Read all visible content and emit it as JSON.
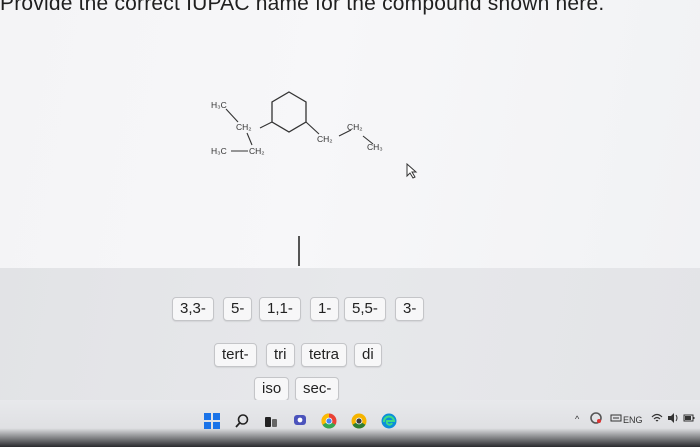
{
  "question": {
    "text": "Provide the correct IUPAC name for the compound shown here."
  },
  "structure_labels": {
    "h3c_top": "H₃C",
    "ch2_left": "CH₂",
    "h3c_bottom": "H₃C",
    "ch2_bottom": "CH₂",
    "ch2_right": "CH₂",
    "ch2_right_top": "CH₂",
    "ch3_right": "CH₃"
  },
  "tokens": {
    "row1": [
      "3,3-",
      "5-",
      "1,1-",
      "1-",
      "5,5-",
      "3-"
    ],
    "row2": [
      "tert-",
      "tri",
      "tetra",
      "di"
    ],
    "row3": [
      "iso",
      "sec-"
    ]
  },
  "taskbar": {
    "icons": [
      "windows-start-icon",
      "search-icon",
      "task-view-icon",
      "teams-chat-icon",
      "chrome-icon",
      "chrome-canary-icon",
      "edge-icon"
    ],
    "tray_language": "ENG"
  }
}
